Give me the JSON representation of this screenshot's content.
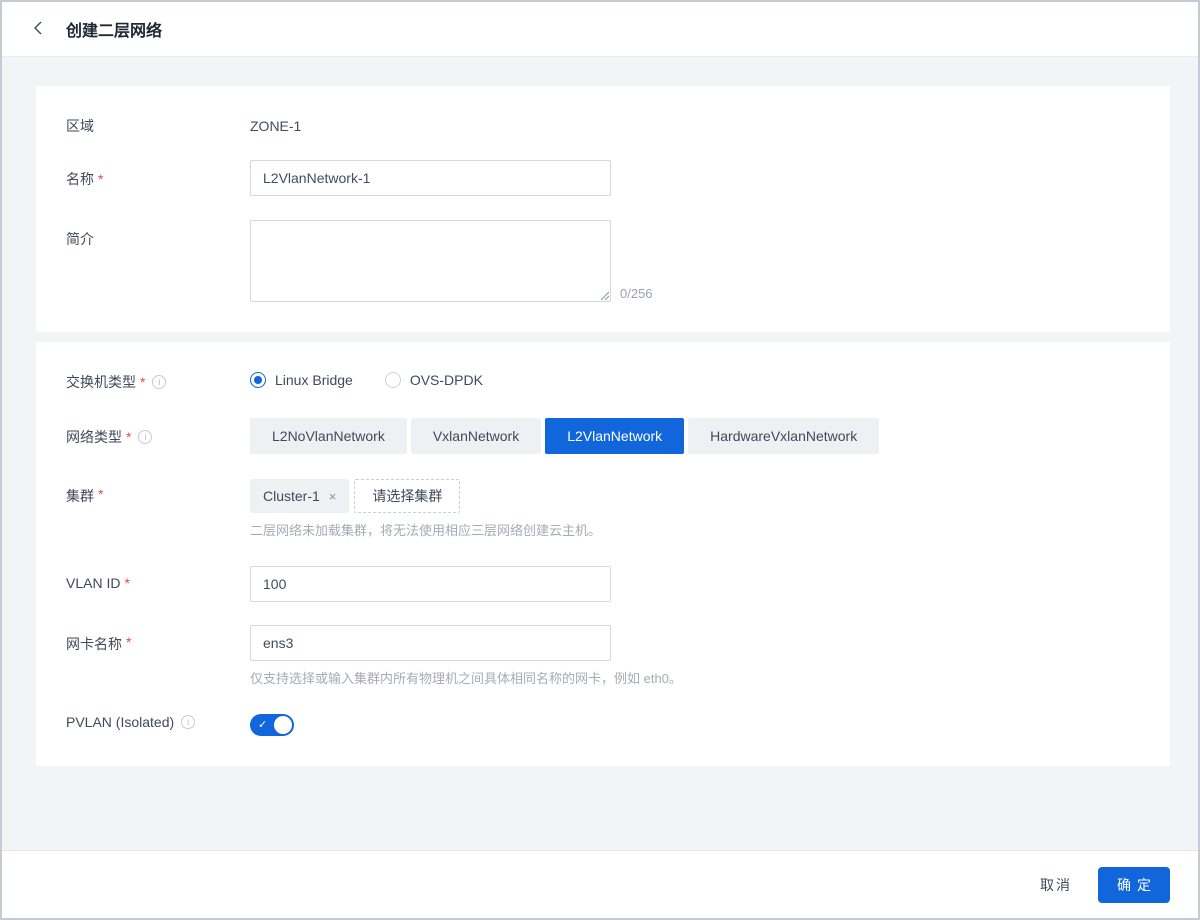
{
  "colors": {
    "primary": "#1266db",
    "required_mark": "#e5484d"
  },
  "marks": {
    "required": "*",
    "info": "i",
    "close": "×",
    "check": "✓"
  },
  "header": {
    "title": "创建二层网络"
  },
  "basic": {
    "zone": {
      "label": "区域",
      "value": "ZONE-1"
    },
    "name": {
      "label": "名称",
      "value": "L2VlanNetwork-1"
    },
    "description": {
      "label": "简介",
      "value": "",
      "counter": "0/256"
    }
  },
  "config": {
    "switch_type": {
      "label": "交换机类型",
      "options": [
        "Linux Bridge",
        "OVS-DPDK"
      ],
      "selected": "Linux Bridge"
    },
    "network_type": {
      "label": "网络类型",
      "options": [
        "L2NoVlanNetwork",
        "VxlanNetwork",
        "L2VlanNetwork",
        "HardwareVxlanNetwork"
      ],
      "selected": "L2VlanNetwork"
    },
    "cluster": {
      "label": "集群",
      "tags": [
        "Cluster-1"
      ],
      "select_button": "请选择集群",
      "hint": "二层网络未加载集群，将无法使用相应三层网络创建云主机。"
    },
    "vlan_id": {
      "label": "VLAN ID",
      "value": "100"
    },
    "nic_name": {
      "label": "网卡名称",
      "value": "ens3",
      "hint": "仅支持选择或输入集群内所有物理机之间具体相同名称的网卡，例如 eth0。"
    },
    "pvlan": {
      "label": "PVLAN (Isolated)",
      "enabled": true
    }
  },
  "footer": {
    "cancel": "取消",
    "confirm": "确定"
  }
}
